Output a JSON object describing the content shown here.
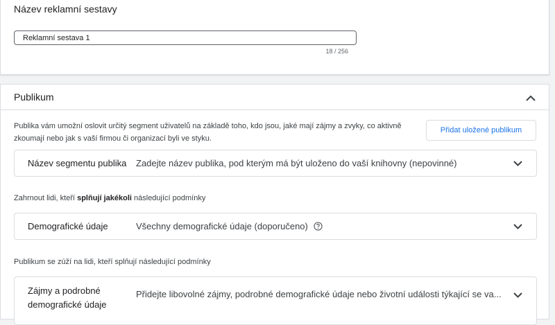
{
  "name_card": {
    "title": "Název reklamní sestavy",
    "input_value": "Reklamní sestava 1",
    "char_count": "18 / 256"
  },
  "audience_card": {
    "title": "Publikum",
    "collapse_icon": "chevron-up-icon",
    "description": "Publika vám umožní oslovit určitý segment uživatelů na základě toho, kdo jsou, jaké mají zájmy a zvyky, co aktivně zkoumají nebo jak s vaší firmou či organizací byli ve styku.",
    "add_saved_button": "Přidat uložené publikum",
    "segment_row": {
      "label": "Název segmentu publika",
      "value": "Zadejte název publika, pod kterým má být uloženo do vaší knihovny (nepovinné)"
    },
    "include_text": {
      "prefix": "Zahrnout lidi, kteří ",
      "bold": "splňují jakékoli",
      "suffix": " následující podmínky"
    },
    "demographic_row": {
      "label": "Demografické údaje",
      "value": "Všechny demografické údaje (doporučeno)",
      "help_icon": "help-circle-icon"
    },
    "narrow_text": "Publikum se zúží na lidi, kteří splňují následující podmínky",
    "interest_row": {
      "label": "Zájmy a podrobné demografické údaje",
      "value": "Přidejte libovolné zájmy, podrobné demografické údaje nebo životní události týkající se va..."
    }
  },
  "colors": {
    "accent": "#1a73e8",
    "border": "#dadce0",
    "background": "#f1f3f4"
  }
}
